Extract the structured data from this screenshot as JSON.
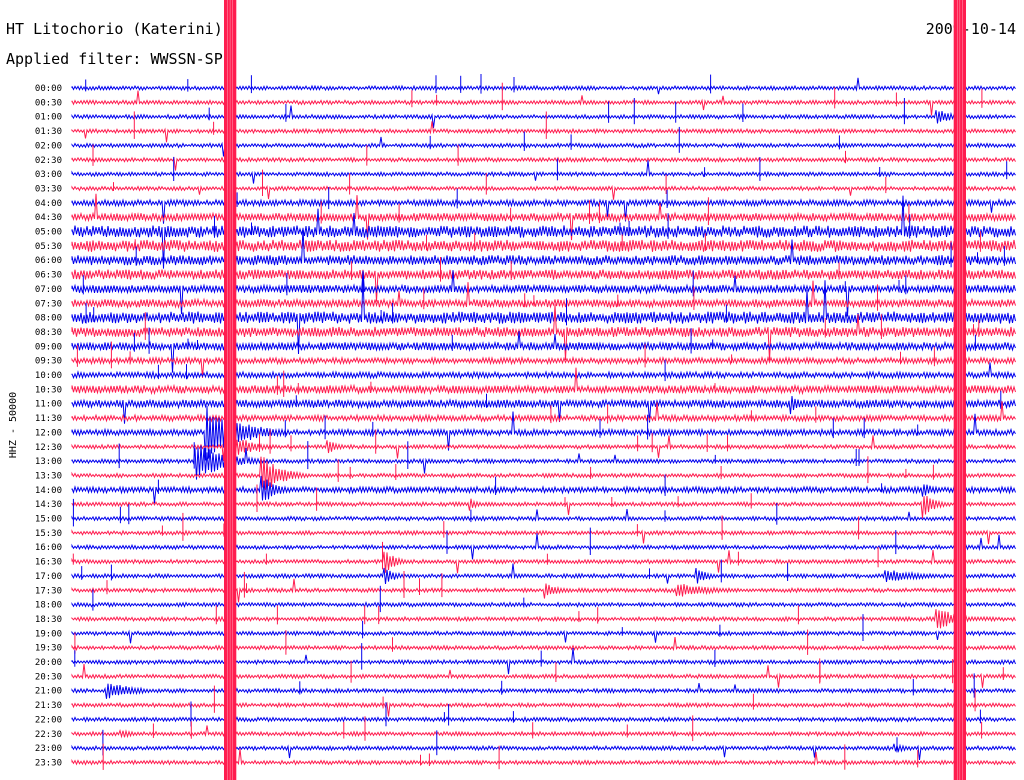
{
  "header": {
    "station": "HT Litochorio (Katerini)",
    "date": "2009-10-14",
    "filter": "Applied filter: WWSSN-SP"
  },
  "chart_data": {
    "type": "line",
    "title": "HT Litochorio (Katerini)",
    "ylabel": "HHZ - 50000",
    "rows": [
      "00:00",
      "00:30",
      "01:00",
      "01:30",
      "02:00",
      "02:30",
      "03:00",
      "03:30",
      "04:00",
      "04:30",
      "05:00",
      "05:30",
      "06:00",
      "06:30",
      "07:00",
      "07:30",
      "08:00",
      "08:30",
      "09:00",
      "09:30",
      "10:00",
      "10:30",
      "11:00",
      "11:30",
      "12:00",
      "12:30",
      "13:00",
      "13:30",
      "14:00",
      "14:30",
      "15:00",
      "15:30",
      "16:00",
      "16:30",
      "17:00",
      "17:30",
      "18:00",
      "18:30",
      "19:00",
      "19:30",
      "20:00",
      "20:30",
      "21:00",
      "21:30",
      "22:00",
      "22:30",
      "23:00",
      "23:30"
    ],
    "series_colors": [
      "#0000ee",
      "#ff1d4f"
    ],
    "noise_level": [
      2,
      2,
      2,
      2,
      2,
      2,
      2,
      2,
      3,
      4,
      6,
      6,
      5,
      5,
      4,
      4,
      6,
      5,
      4,
      3,
      3,
      4,
      4,
      3,
      3,
      2,
      2,
      2,
      3,
      2,
      2,
      2,
      2,
      2,
      2,
      2,
      2,
      2,
      2,
      2,
      2,
      2,
      2,
      2,
      2,
      2,
      2,
      2
    ],
    "events": [
      {
        "row": 2,
        "start": 0.915,
        "dur": 0.04,
        "amp": 9
      },
      {
        "row": 22,
        "start": 0.76,
        "dur": 0.03,
        "amp": 12
      },
      {
        "row": 24,
        "start": 0.14,
        "dur": 0.09,
        "amp": 30
      },
      {
        "row": 25,
        "start": 0.16,
        "dur": 0.06,
        "amp": 18
      },
      {
        "row": 25,
        "start": 0.27,
        "dur": 0.03,
        "amp": 8
      },
      {
        "row": 26,
        "start": 0.13,
        "dur": 0.08,
        "amp": 20
      },
      {
        "row": 27,
        "start": 0.2,
        "dur": 0.05,
        "amp": 22
      },
      {
        "row": 28,
        "start": 0.2,
        "dur": 0.04,
        "amp": 16
      },
      {
        "row": 28,
        "start": 0.9,
        "dur": 0.03,
        "amp": 10
      },
      {
        "row": 29,
        "start": 0.42,
        "dur": 0.02,
        "amp": 8
      },
      {
        "row": 29,
        "start": 0.9,
        "dur": 0.03,
        "amp": 16
      },
      {
        "row": 33,
        "start": 0.33,
        "dur": 0.03,
        "amp": 14
      },
      {
        "row": 34,
        "start": 0.33,
        "dur": 0.03,
        "amp": 10
      },
      {
        "row": 34,
        "start": 0.66,
        "dur": 0.03,
        "amp": 10
      },
      {
        "row": 34,
        "start": 0.86,
        "dur": 0.1,
        "amp": 7
      },
      {
        "row": 35,
        "start": 0.5,
        "dur": 0.04,
        "amp": 9
      },
      {
        "row": 35,
        "start": 0.64,
        "dur": 0.09,
        "amp": 8
      },
      {
        "row": 37,
        "start": 0.915,
        "dur": 0.05,
        "amp": 14
      },
      {
        "row": 42,
        "start": 0.035,
        "dur": 0.07,
        "amp": 10
      },
      {
        "row": 45,
        "start": 0.05,
        "dur": 0.04,
        "amp": 5
      },
      {
        "row": 46,
        "start": 0.87,
        "dur": 0.04,
        "amp": 5
      }
    ],
    "clipped_bands": [
      {
        "x_frac": 0.161,
        "width_frac": 0.013,
        "color": "#ff1d4f"
      },
      {
        "x_frac": 0.934,
        "width_frac": 0.013,
        "color": "#ff1d4f"
      }
    ]
  }
}
